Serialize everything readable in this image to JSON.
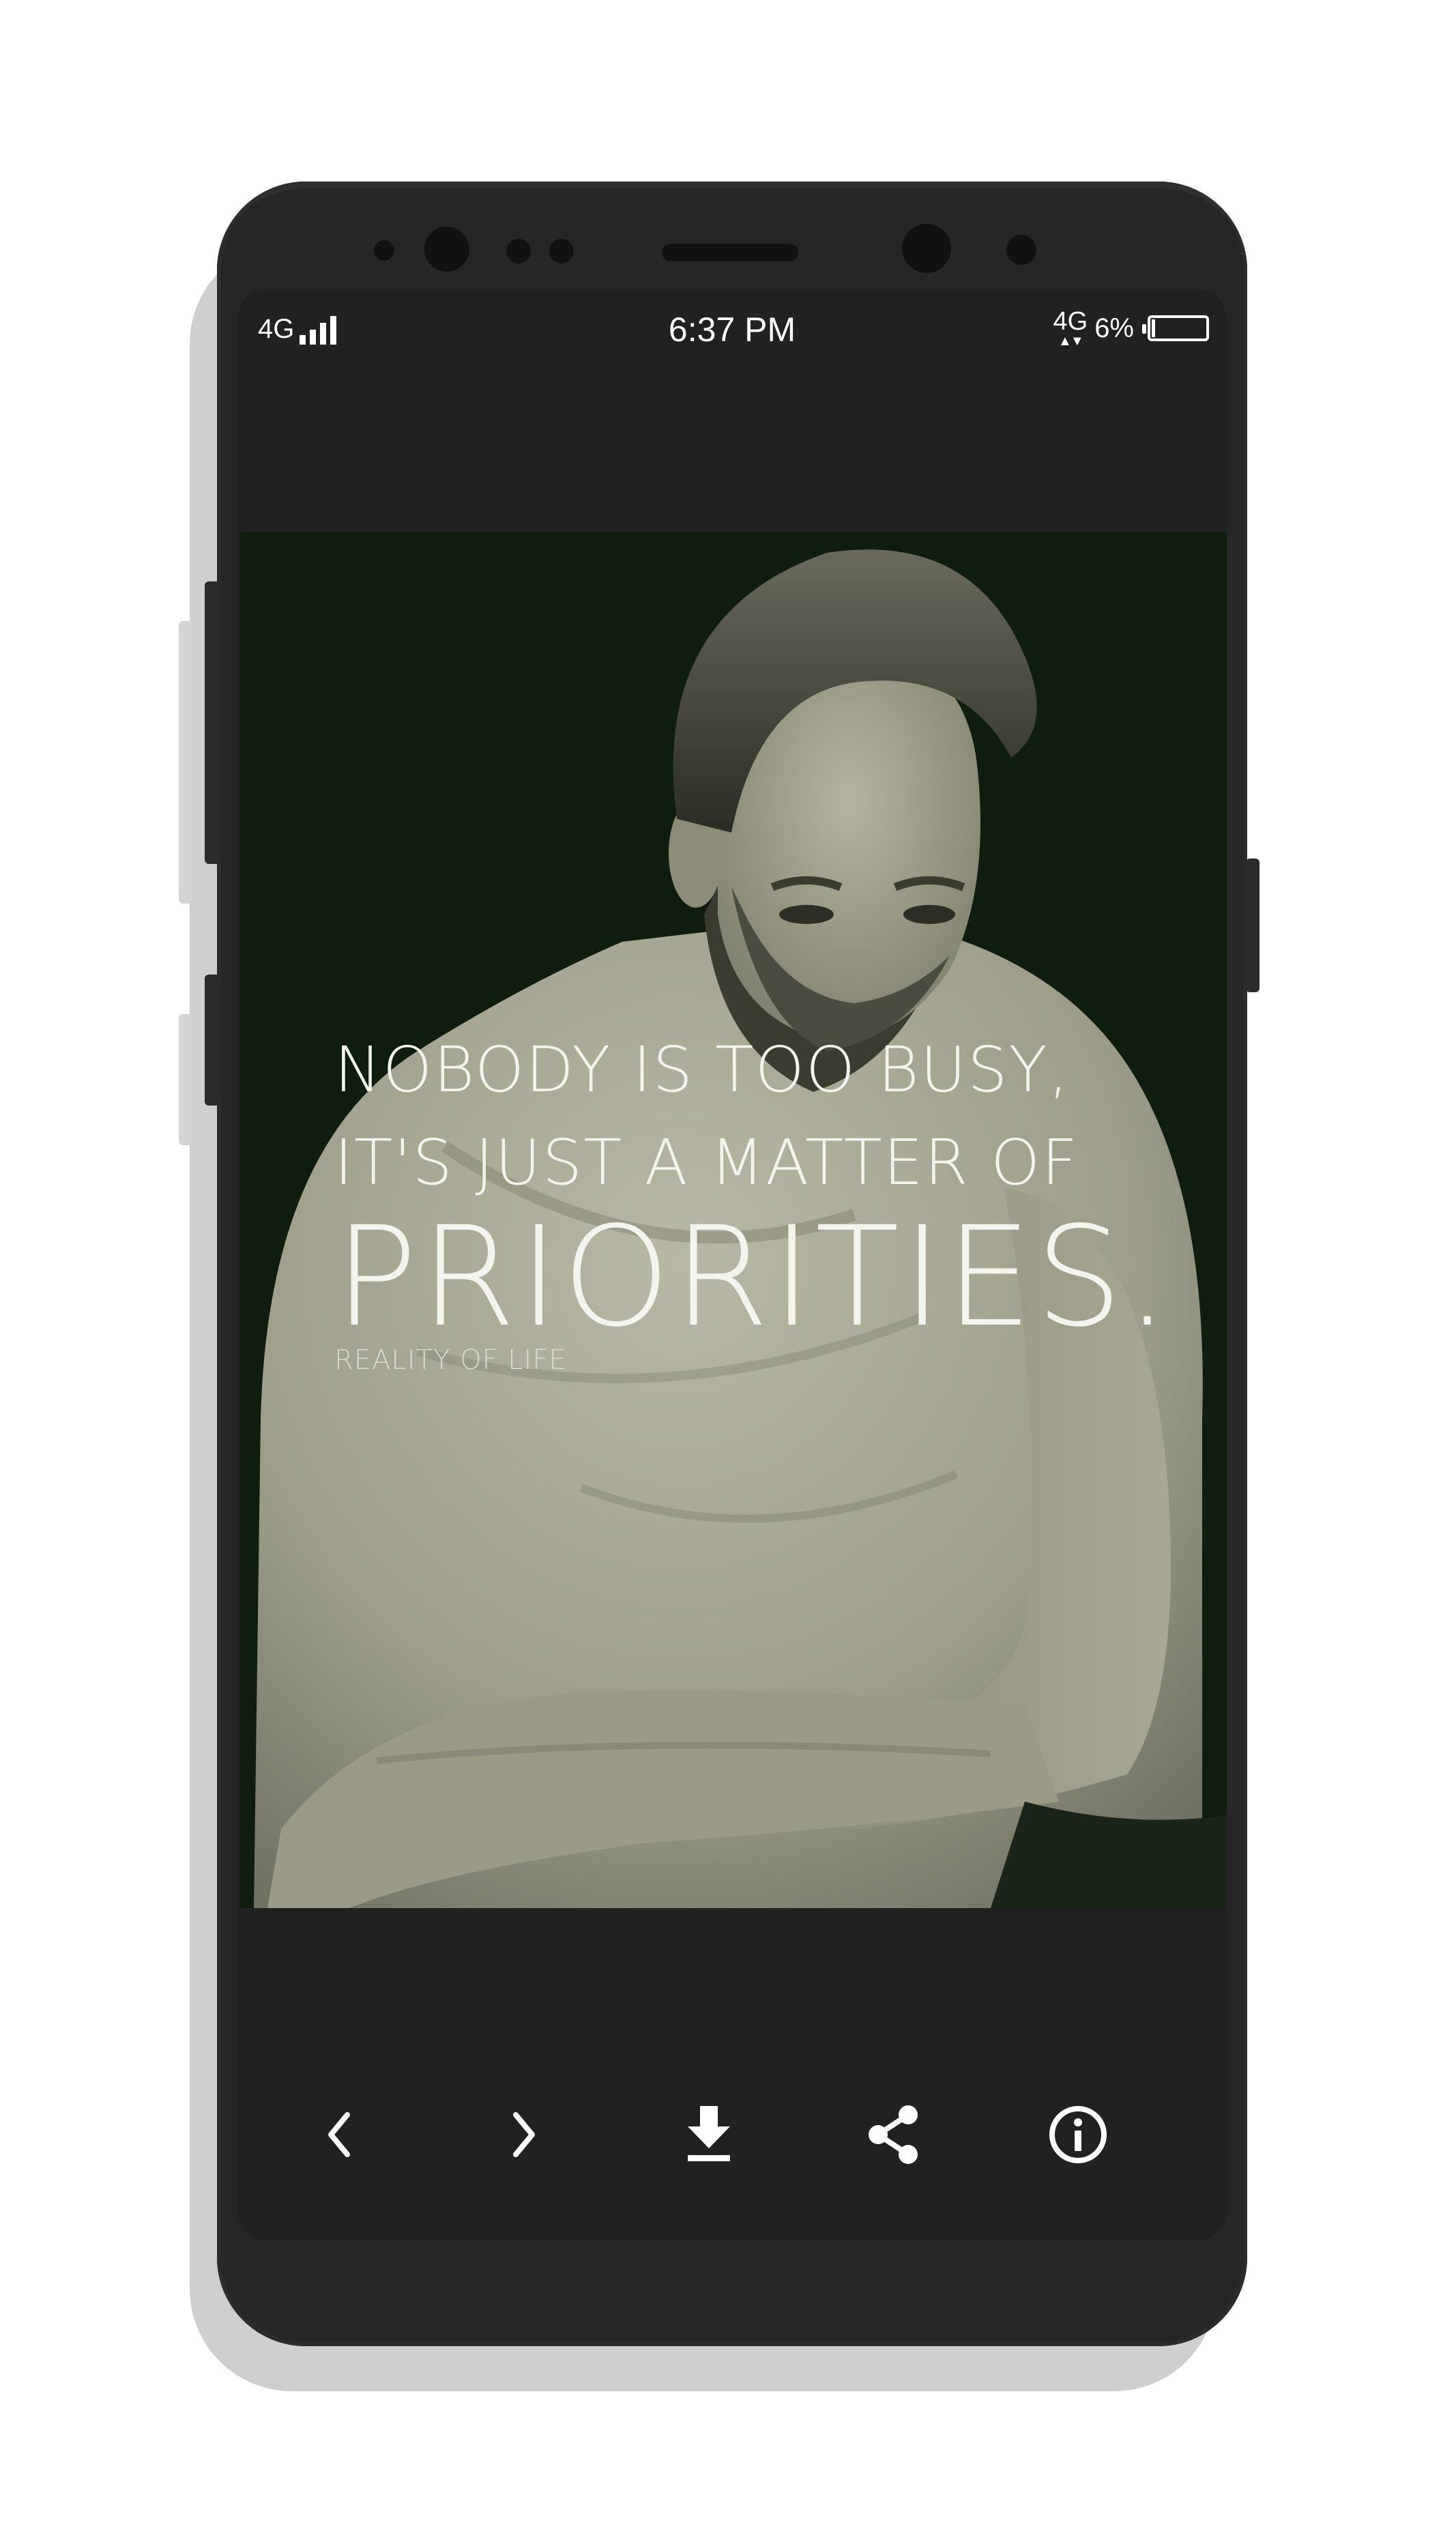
{
  "status_bar": {
    "network_left": "4G",
    "time": "6:37 PM",
    "network_right": "4G",
    "battery_percent_label": "6%",
    "battery_level": 0.06
  },
  "wallpaper": {
    "quote_line1": "NOBODY IS TOO BUSY,",
    "quote_line2": "IT'S JUST A MATTER OF",
    "quote_line3": "PRIORITIES.",
    "credit": "REALITY OF LIFE"
  },
  "toolbar": {
    "buttons": [
      {
        "icon": "chevron-left-icon"
      },
      {
        "icon": "chevron-right-icon"
      },
      {
        "icon": "download-icon"
      },
      {
        "icon": "share-icon"
      },
      {
        "icon": "info-icon"
      }
    ]
  },
  "colors": {
    "screen_bg": "#212121",
    "phone_body": "#262626",
    "photo_bg": "#0e1d0d",
    "text": "#ffffff"
  }
}
